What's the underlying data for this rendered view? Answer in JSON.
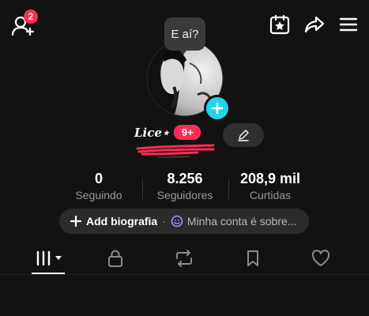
{
  "header": {
    "friend_requests_count": "2",
    "icons": [
      "add-friend-icon",
      "calendar-star-icon",
      "share-icon",
      "menu-icon"
    ]
  },
  "avatar": {
    "status_bubble": "E aí?"
  },
  "profile": {
    "username": "Lice⋆",
    "messages_badge": "9+"
  },
  "stats": [
    {
      "value": "0",
      "label": "Seguindo"
    },
    {
      "value": "8.256",
      "label": "Seguidores"
    },
    {
      "value": "208,9 mil",
      "label": "Curtidas"
    }
  ],
  "bio": {
    "add_label": "Add biografia",
    "separator": "·",
    "about_label": "Minha conta é sobre..."
  },
  "tabs": [
    "videos-grid-icon",
    "lock-icon",
    "repost-icon",
    "bookmark-icon",
    "heart-icon"
  ],
  "colors": {
    "background": "#121212",
    "accent_red": "#fe2c55",
    "accent_cyan": "#20d5ec"
  }
}
